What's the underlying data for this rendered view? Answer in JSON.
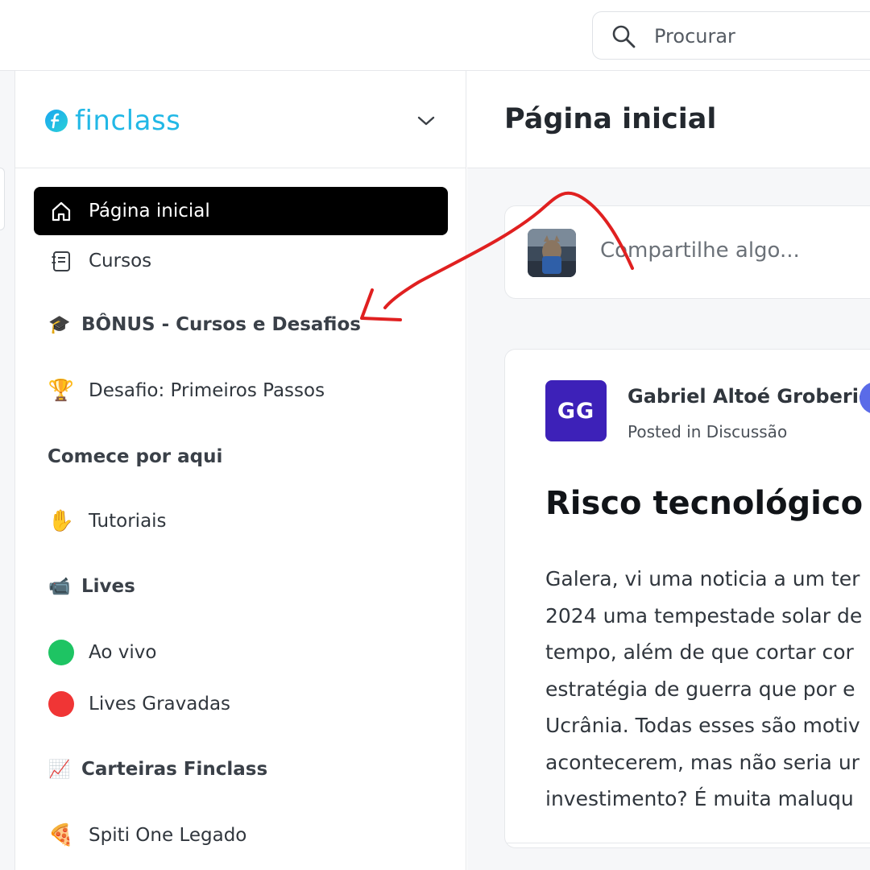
{
  "search": {
    "placeholder": "Procurar",
    "icon": "search-icon"
  },
  "brand": {
    "name": "finclass",
    "color": "#22b8e6"
  },
  "sidebar": {
    "items": [
      {
        "id": "home",
        "label": "Página inicial",
        "icon": "home-icon",
        "active": true
      },
      {
        "id": "courses",
        "label": "Cursos",
        "icon": "book-icon",
        "active": false
      }
    ],
    "bonus_section": {
      "emoji": "🎓",
      "label": "BÔNUS - Cursos e Desafios"
    },
    "bonus_items": [
      {
        "emoji": "🏆",
        "label": "Desafio: Primeiros Passos"
      }
    ],
    "start_section": {
      "label": "Comece por aqui"
    },
    "start_items": [
      {
        "emoji": "✋",
        "label": "Tutoriais"
      }
    ],
    "lives_section": {
      "emoji": "📹",
      "label": "Lives"
    },
    "lives_items": [
      {
        "label": "Ao vivo",
        "dot_color": "#1ec463"
      },
      {
        "label": "Lives Gravadas",
        "dot_color": "#f03535"
      }
    ],
    "wallets_section": {
      "emoji": "📈",
      "label": "Carteiras Finclass"
    },
    "wallets_items": [
      {
        "emoji": "🍕",
        "label": "Spiti One Legado"
      }
    ]
  },
  "main": {
    "title": "Página inicial",
    "composer": {
      "placeholder": "Compartilhe algo..."
    },
    "post": {
      "initials": "GG",
      "author": "Gabriel Altoé Groberio",
      "meta_prefix": "Posted in ",
      "meta_space": "Discussão",
      "title": "Risco tecnológico",
      "body_lines": [
        "Galera, vi uma noticia a um ter",
        "2024 uma tempestade solar de",
        "tempo, além de que cortar cor",
        "estratégia de guerra que por e",
        "Ucrânia. Todas esses são motiv",
        "acontecerem, mas não seria ur",
        "investimento? É muita maluqu"
      ]
    }
  },
  "colors": {
    "active_bg": "#000000",
    "avatar_bg": "#3d21b8",
    "annotation": "#e02020"
  }
}
